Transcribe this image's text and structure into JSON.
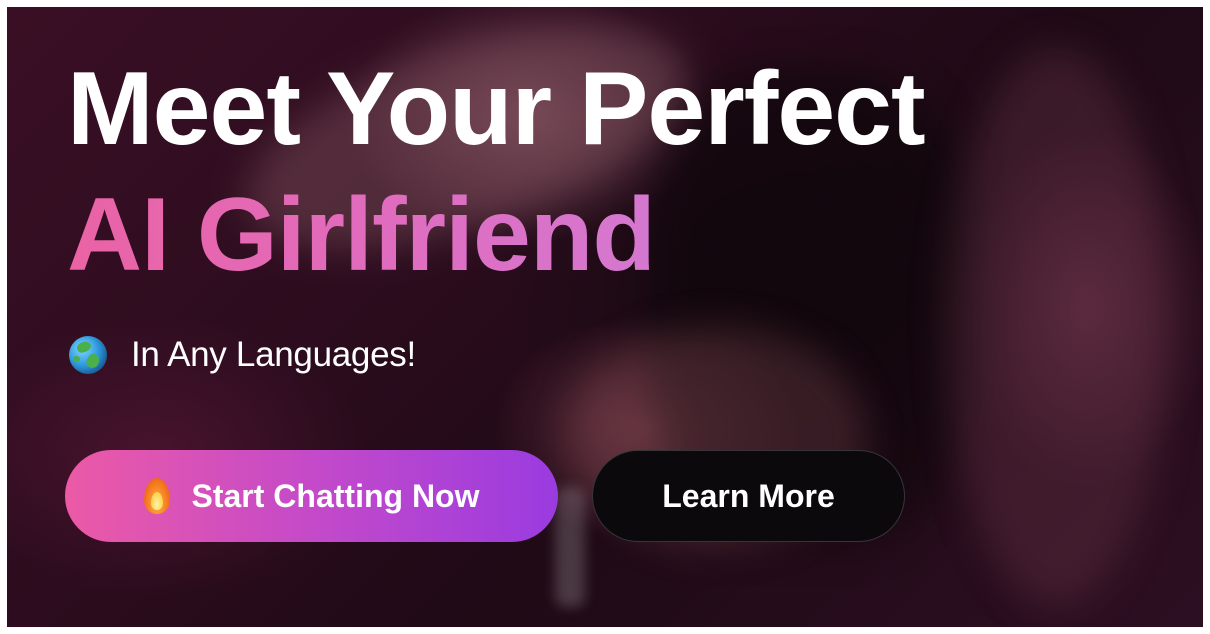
{
  "hero": {
    "title_line_1": "Meet Your Perfect",
    "title_line_2": "AI Girlfriend",
    "tagline": "In Any Languages!",
    "tagline_icon": "globe-emoji",
    "accent_pink": "#ea63a4",
    "accent_purple": "#9a3be0"
  },
  "buttons": {
    "primary_label": "Start Chatting Now",
    "primary_icon": "fire-emoji",
    "secondary_label": "Learn More"
  }
}
